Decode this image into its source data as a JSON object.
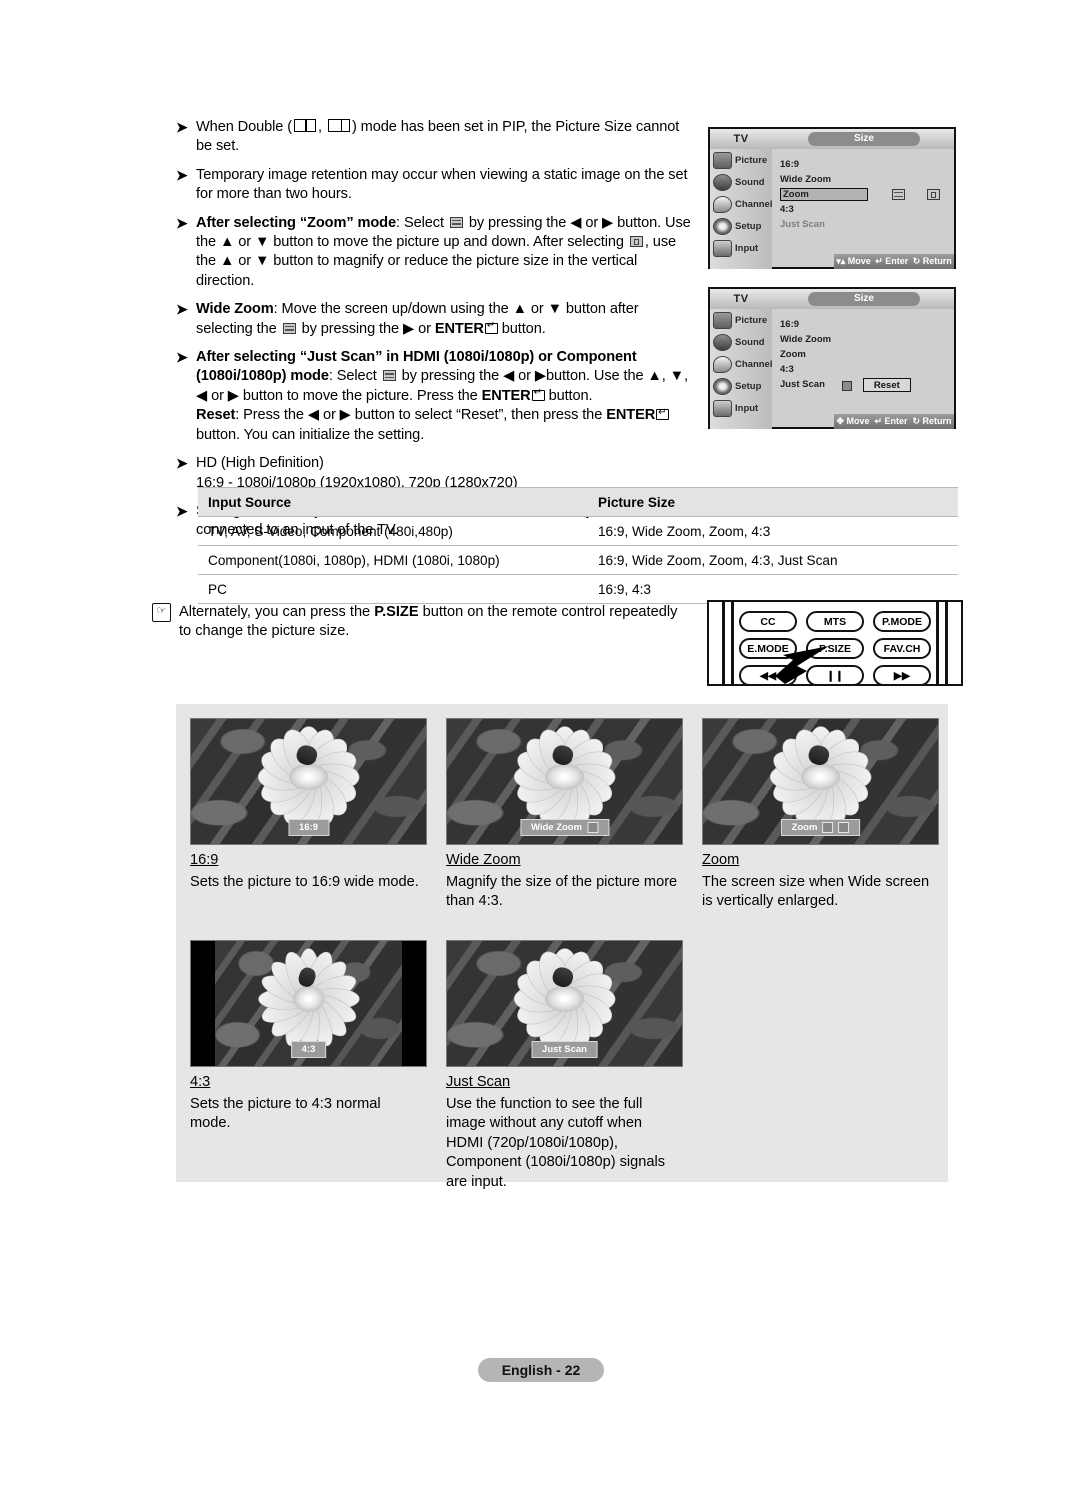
{
  "bullets": [
    {
      "marker": "➤",
      "segments": [
        {
          "t": "text",
          "v": "When Double ("
        },
        {
          "t": "pip1"
        },
        {
          "t": "text",
          "v": ", "
        },
        {
          "t": "pip2"
        },
        {
          "t": "text",
          "v": ") mode has been set in PIP, the Picture Size cannot be set."
        }
      ]
    },
    {
      "marker": "➤",
      "segments": [
        {
          "t": "text",
          "v": "Temporary image retention may occur when viewing a static image on the set for more than two hours."
        }
      ]
    },
    {
      "marker": "➤",
      "segments": [
        {
          "t": "bold",
          "v": "After selecting “Zoom” mode"
        },
        {
          "t": "text",
          "v": ": Select "
        },
        {
          "t": "icon-bars"
        },
        {
          "t": "text",
          "v": " by pressing the ◀ or ▶ button. Use the ▲ or ▼ button to move the picture up and down. After selecting "
        },
        {
          "t": "icon-box"
        },
        {
          "t": "text",
          "v": ", use the ▲ or ▼ button to magnify or reduce the picture size in the vertical direction."
        }
      ]
    },
    {
      "marker": "➤",
      "segments": [
        {
          "t": "bold",
          "v": "Wide Zoom"
        },
        {
          "t": "text",
          "v": ": Move the screen up/down using the ▲ or ▼ button after selecting the "
        },
        {
          "t": "icon-bars"
        },
        {
          "t": "text",
          "v": " by pressing the ▶ or "
        },
        {
          "t": "bold",
          "v": "ENTER"
        },
        {
          "t": "enter"
        },
        {
          "t": "text",
          "v": " button."
        }
      ]
    },
    {
      "marker": "➤",
      "segments": [
        {
          "t": "bold",
          "v": "After selecting “Just Scan” in HDMI (1080i/1080p) or Component (1080i/1080p) mode"
        },
        {
          "t": "text",
          "v": ": Select "
        },
        {
          "t": "icon-bars"
        },
        {
          "t": "text",
          "v": " by pressing the ◀ or ▶button. Use the ▲, ▼, ◀ or ▶ button to move the picture. Press the "
        },
        {
          "t": "bold",
          "v": "ENTER"
        },
        {
          "t": "enter"
        },
        {
          "t": "text",
          "v": " button. "
        },
        {
          "t": "br"
        },
        {
          "t": "bold",
          "v": "Reset"
        },
        {
          "t": "text",
          "v": ": Press the ◀ or ▶ button to select “Reset”, then press the "
        },
        {
          "t": "bold",
          "v": "ENTER"
        },
        {
          "t": "enter"
        },
        {
          "t": "text",
          "v": " button. You can initialize the setting."
        }
      ]
    },
    {
      "marker": "➤",
      "segments": [
        {
          "t": "text",
          "v": "HD (High Definition)"
        },
        {
          "t": "br"
        },
        {
          "t": "text",
          "v": "16:9 - 1080i/1080p (1920x1080), 720p (1280x720)"
        }
      ]
    },
    {
      "marker": "➤",
      "segments": [
        {
          "t": "text",
          "v": "Settings can be adjusted and stored for each external device you have connected to an input of the TV."
        }
      ]
    }
  ],
  "osd": {
    "tv_label": "TV",
    "title": "Size",
    "menu_items": [
      "Picture",
      "Sound",
      "Channel",
      "Setup",
      "Input"
    ],
    "options": [
      "16:9",
      "Wide Zoom",
      "Zoom",
      "4:3",
      "Just Scan"
    ],
    "bottom_bar": {
      "move": "Move",
      "enter": "Enter",
      "return": "Return"
    },
    "reset_label": "Reset",
    "screen1": {
      "highlighted": "Zoom"
    },
    "screen2": {
      "highlighted": "Just Scan"
    }
  },
  "table": {
    "headers": [
      "Input Source",
      "Picture Size"
    ],
    "rows": [
      [
        "TV, AV, S-Video, Component (480i,480p)",
        "16:9, Wide Zoom, Zoom, 4:3"
      ],
      [
        "Component(1080i, 1080p), HDMI (1080i, 1080p)",
        "16:9, Wide Zoom, Zoom, 4:3, Just Scan"
      ],
      [
        "PC",
        "16:9, 4:3"
      ]
    ]
  },
  "note": {
    "icon": "note-hand-icon",
    "text_before": "Alternately, you can press the ",
    "bold": "P.SIZE",
    "text_after": " button on the remote control repeatedly to change the picture size."
  },
  "remote": {
    "row1": [
      "CC",
      "MTS",
      "P.MODE"
    ],
    "row2": [
      "E.MODE",
      "P.SIZE",
      "FAV.CH"
    ],
    "highlight": "P.SIZE"
  },
  "examples": [
    {
      "id": "ex-169",
      "tag": "16:9",
      "tag_icons": 0,
      "pillar": false,
      "caption": "16:9",
      "desc": "Sets the picture to 16:9 wide mode."
    },
    {
      "id": "ex-widezoom",
      "tag": "Wide Zoom",
      "tag_icons": 1,
      "pillar": false,
      "caption": "Wide Zoom",
      "desc": "Magnify the size of the picture more than 4:3."
    },
    {
      "id": "ex-zoom",
      "tag": "Zoom",
      "tag_icons": 2,
      "pillar": false,
      "caption": "Zoom",
      "desc": "The screen size when Wide screen is vertically enlarged."
    },
    {
      "id": "ex-43",
      "tag": "4:3",
      "tag_icons": 0,
      "pillar": true,
      "caption": "4:3",
      "desc": "Sets the picture to 4:3 normal mode."
    },
    {
      "id": "ex-justscan",
      "tag": "Just Scan",
      "tag_icons": 0,
      "pillar": false,
      "caption": "Just Scan",
      "desc": "Use the function to see the full image without any cutoff when HDMI (720p/1080i/1080p), Component (1080i/1080p) signals are input."
    }
  ],
  "footer": {
    "label": "English - 22"
  },
  "colors": {
    "panel_bg": "#e6e6e6",
    "table_header": "#e3e3e3",
    "footer_pill": "#b5b5b5",
    "osd_bg": "#cfcfcf"
  }
}
